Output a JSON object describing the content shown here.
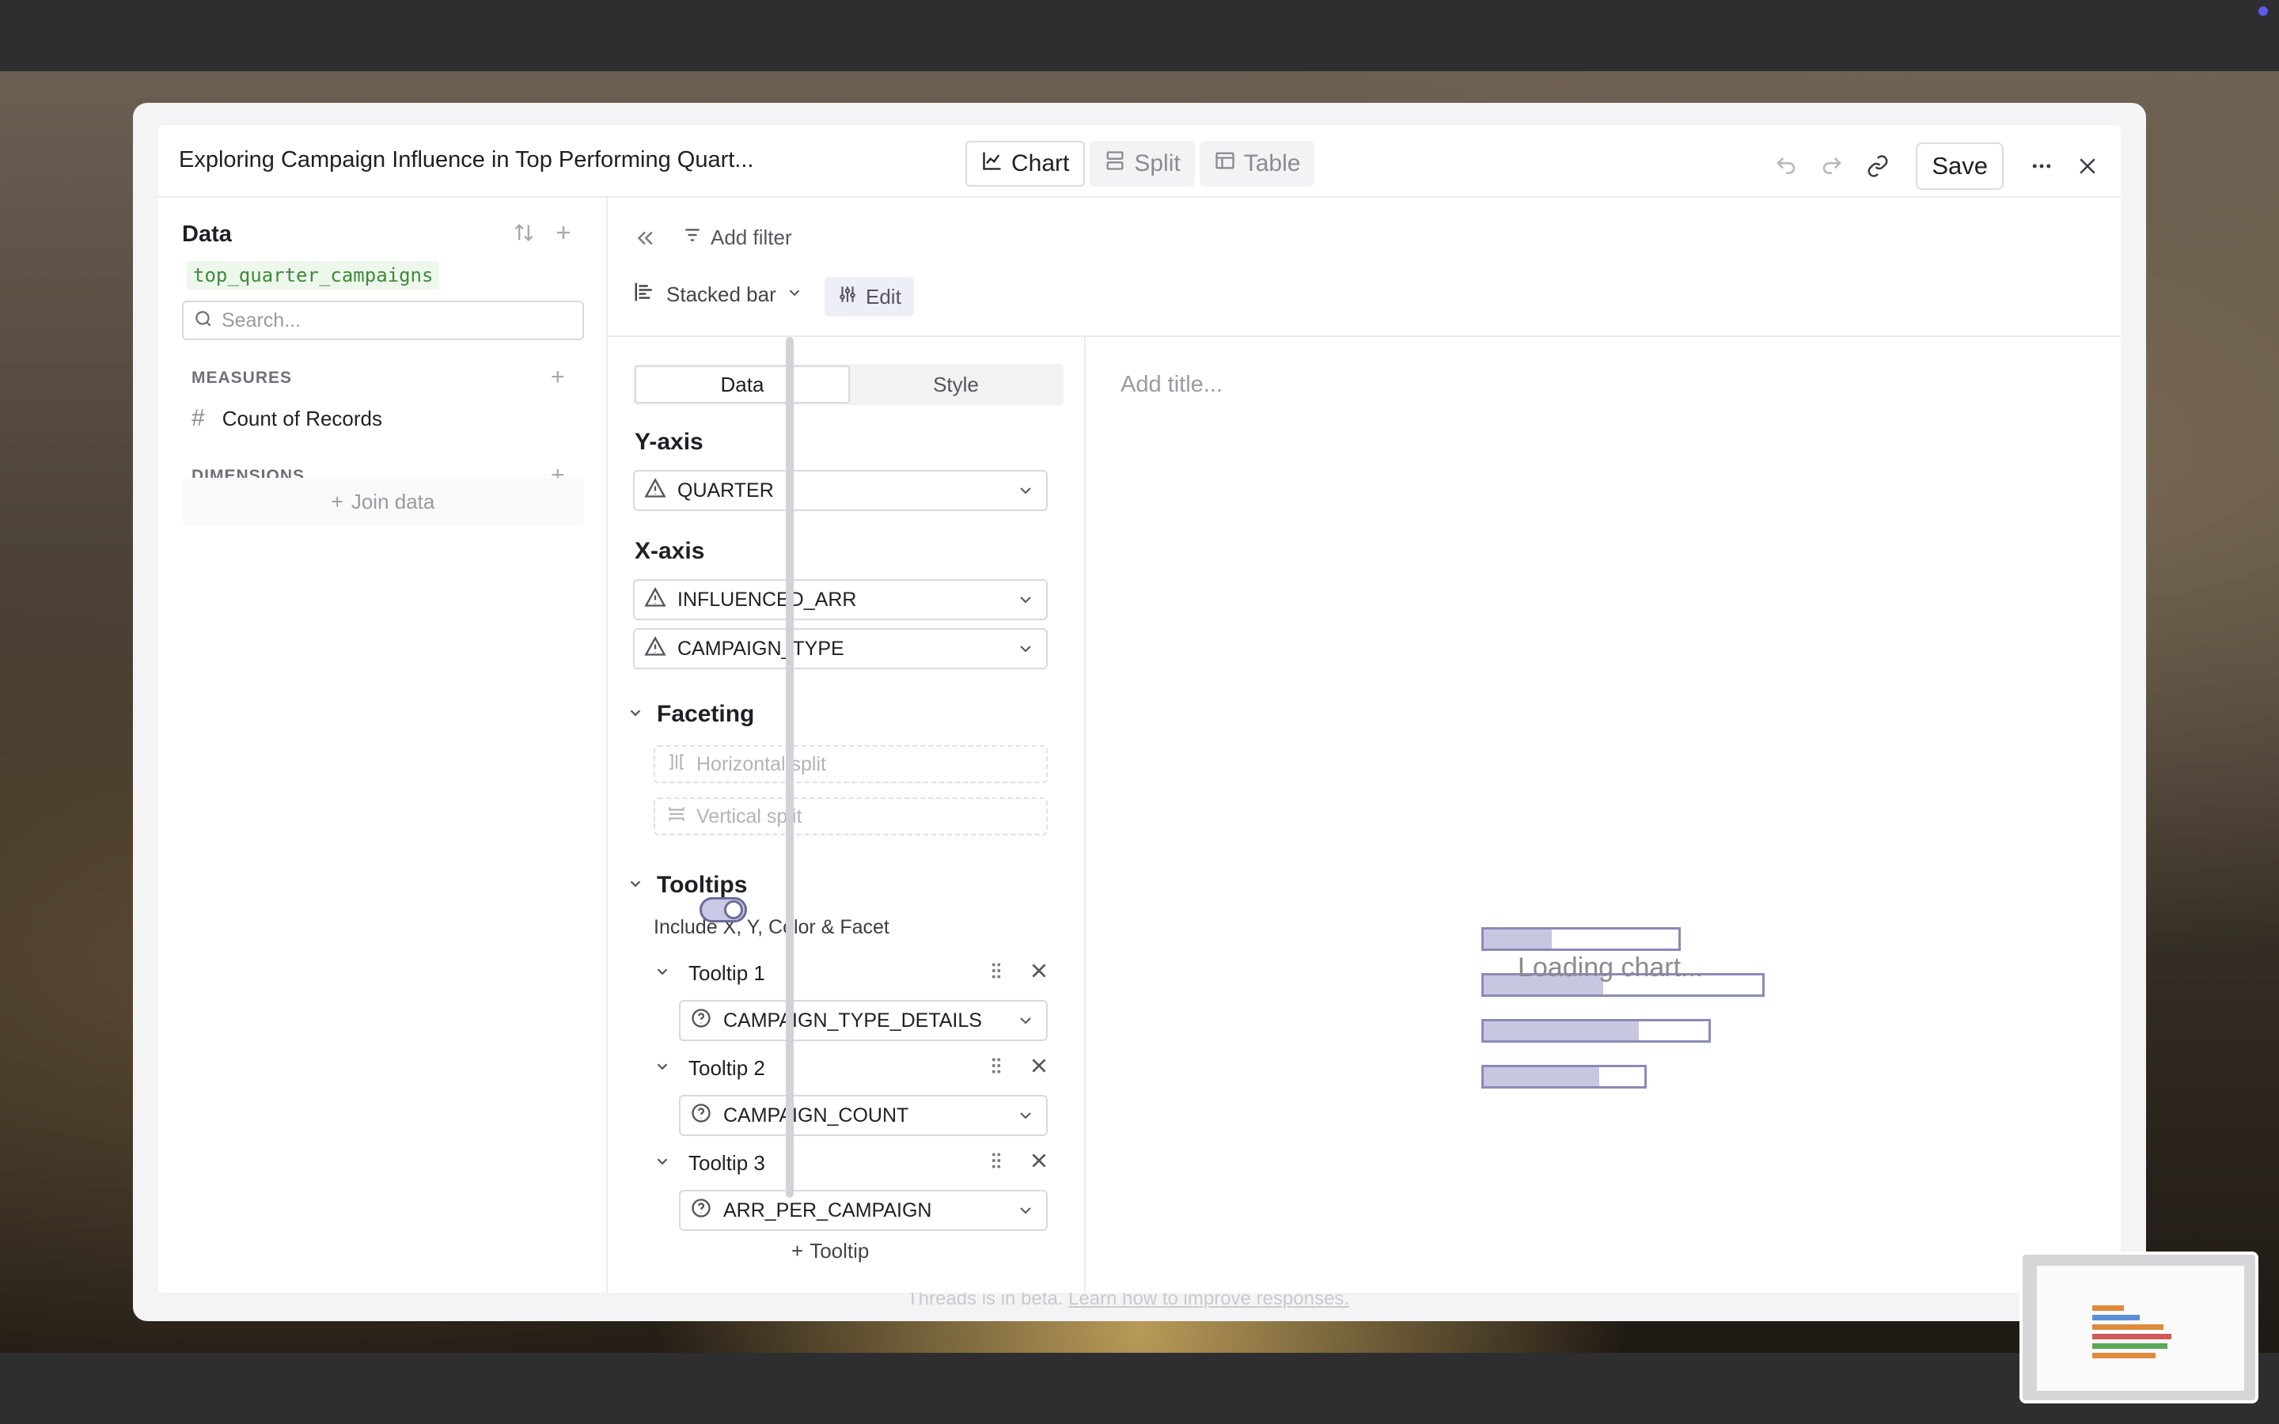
{
  "header": {
    "title": "Exploring Campaign Influence in Top Performing Quart...",
    "tabs": [
      {
        "label": "Chart",
        "active": true
      },
      {
        "label": "Split",
        "active": false
      },
      {
        "label": "Table",
        "active": false
      }
    ],
    "save_label": "Save"
  },
  "sidebar": {
    "title": "Data",
    "table_name": "top_quarter_campaigns",
    "search_placeholder": "Search...",
    "measures_label": "MEASURES",
    "measures": [
      {
        "name": "Count of Records"
      }
    ],
    "dimensions_label": "DIMENSIONS",
    "join_label": "Join data"
  },
  "toolbar": {
    "add_filter_label": "Add filter",
    "chart_type": "Stacked bar",
    "edit_label": "Edit"
  },
  "config": {
    "tabs": [
      {
        "label": "Data",
        "active": true
      },
      {
        "label": "Style",
        "active": false
      }
    ],
    "y_axis_label": "Y-axis",
    "y_axis_fields": [
      "QUARTER"
    ],
    "x_axis_label": "X-axis",
    "x_axis_fields": [
      "INFLUENCED_ARR",
      "CAMPAIGN_TYPE"
    ],
    "faceting_label": "Faceting",
    "horizontal_split_placeholder": "Horizontal split",
    "vertical_split_placeholder": "Vertical split",
    "tooltips_label": "Tooltips",
    "include_label": "Include X, Y, Color & Facet",
    "include_enabled": true,
    "tooltips": [
      {
        "label": "Tooltip 1",
        "field": "CAMPAIGN_TYPE_DETAILS"
      },
      {
        "label": "Tooltip 2",
        "field": "CAMPAIGN_COUNT"
      },
      {
        "label": "Tooltip 3",
        "field": "ARR_PER_CAMPAIGN"
      }
    ],
    "add_tooltip_label": "Tooltip"
  },
  "preview": {
    "title_placeholder": "Add title...",
    "loading_text": "Loading chart...",
    "loading_bars": [
      {
        "fill": 0.35,
        "length": 1.0
      },
      {
        "fill": 0.43,
        "length": 1.42
      },
      {
        "fill": 0.69,
        "length": 1.15
      },
      {
        "fill": 0.72,
        "length": 0.83
      }
    ]
  },
  "background_footer": {
    "text": "Threads is in beta.",
    "link": "Learn how to improve responses."
  },
  "colors": {
    "accent": "#8b8ab8",
    "loading_fill": "#c8c7e2",
    "table_chip_bg": "#eef7ec",
    "table_chip_text": "#3f8a3a"
  }
}
